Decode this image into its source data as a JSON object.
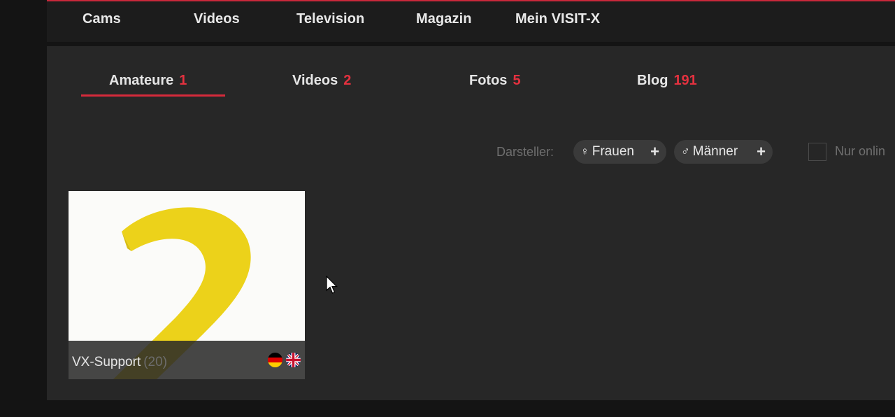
{
  "topnav": {
    "items": [
      {
        "label": "Cams"
      },
      {
        "label": "Videos"
      },
      {
        "label": "Television"
      },
      {
        "label": "Magazin"
      },
      {
        "label": "Mein VISIT-X"
      }
    ]
  },
  "tabs": [
    {
      "label": "Amateure",
      "count": "1",
      "active": true
    },
    {
      "label": "Videos",
      "count": "2"
    },
    {
      "label": "Fotos",
      "count": "5"
    },
    {
      "label": "Blog",
      "count": "191"
    }
  ],
  "filters": {
    "label": "Darsteller:",
    "frauen": {
      "icon": "female-icon",
      "label": "Frauen",
      "action_icon": "plus-icon"
    },
    "maenner": {
      "icon": "male-icon",
      "label": "Männer",
      "action_icon": "plus-icon"
    },
    "online_only": {
      "label": "Nur onlin",
      "checked": false
    }
  },
  "card": {
    "name": "VX-Support",
    "count": "(20)",
    "languages": [
      "german-flag-icon",
      "uk-flag-icon"
    ]
  },
  "colors": {
    "accent": "#e4313f",
    "thumbnail_yellow": "#ecd21a"
  }
}
